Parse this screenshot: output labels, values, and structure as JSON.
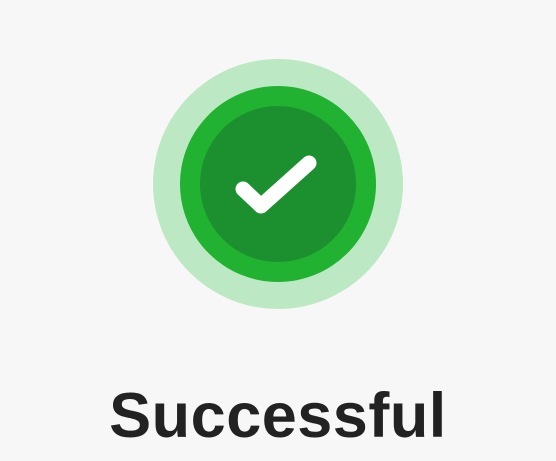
{
  "status": {
    "title": "Successful",
    "icon": "check-circle-icon",
    "colors": {
      "background": "#f7f7f7",
      "outer_halo": "#bde8c4",
      "middle_ring": "#21b232",
      "inner_circle": "#1c8f2e",
      "checkmark": "#ffffff",
      "title_text": "#222222"
    }
  }
}
